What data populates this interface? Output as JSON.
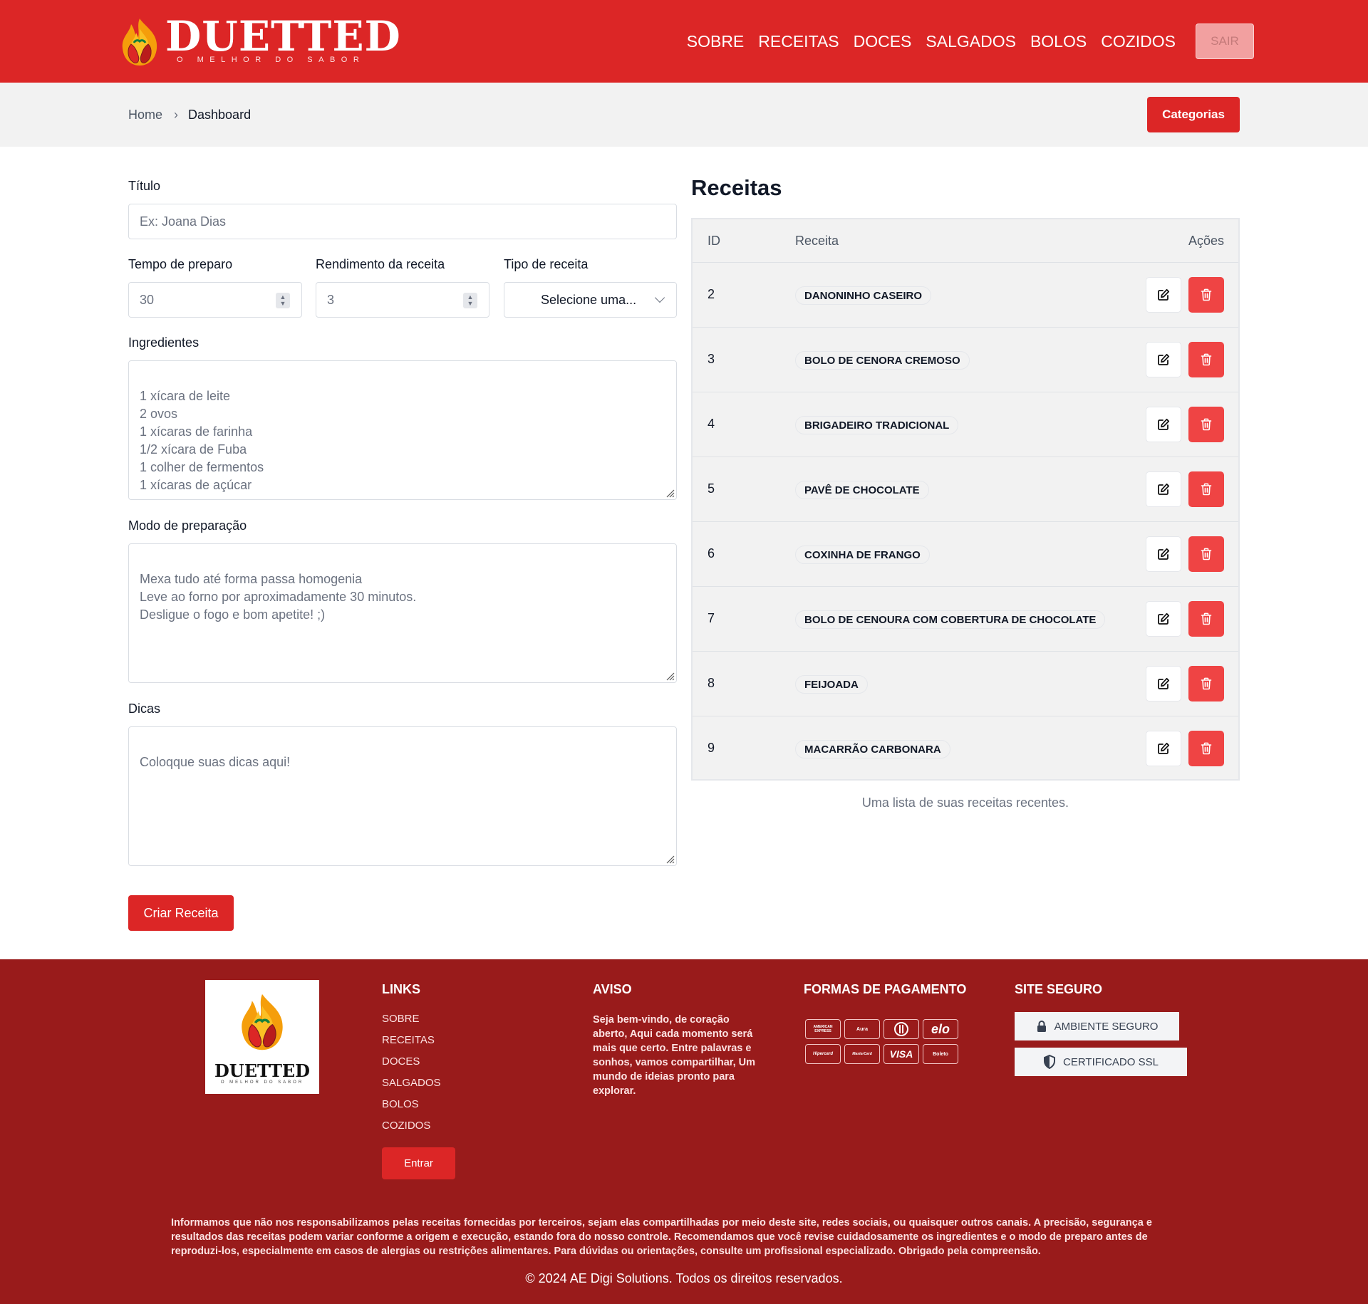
{
  "brand": {
    "name": "DUETTED",
    "tagline": "O MELHOR DO SABOR",
    "accent": "#dc2626",
    "footer_bg": "#991b1b"
  },
  "nav": {
    "items": [
      "SOBRE",
      "RECEITAS",
      "DOCES",
      "SALGADOS",
      "BOLOS",
      "COZIDOS"
    ],
    "logout_label": "SAIR"
  },
  "breadcrumb": {
    "home": "Home",
    "current": "Dashboard"
  },
  "header_actions": {
    "categories_label": "Categorias"
  },
  "form": {
    "title_label": "Título",
    "title_placeholder": "Ex: Joana Dias",
    "prep_time_label": "Tempo de preparo",
    "prep_time_value": "30",
    "yield_label": "Rendimento da receita",
    "yield_value": "3",
    "type_label": "Tipo de receita",
    "type_value": "Selecione uma...",
    "ingredients_label": "Ingredientes",
    "ingredients_placeholder": "1 xícara de leite\n2 ovos\n1 xícaras de farinha\n1/2 xícara de Fuba\n1 colher de fermentos\n1 xícaras de açúcar",
    "method_label": "Modo de preparação",
    "method_placeholder": "Mexa tudo até forma passa homogenia\nLeve ao forno por aproximadamente 30 minutos.\nDesligue o fogo e bom apetite! ;)",
    "tips_label": "Dicas",
    "tips_placeholder": "Coloqque suas dicas aqui!",
    "submit_label": "Criar Receita"
  },
  "recipes": {
    "title": "Receitas",
    "columns": [
      "ID",
      "Receita",
      "Ações"
    ],
    "rows": [
      {
        "id": "2",
        "name": "DANONINHO CASEIRO"
      },
      {
        "id": "3",
        "name": "BOLO DE CENORA CREMOSO"
      },
      {
        "id": "4",
        "name": "BRIGADEIRO TRADICIONAL"
      },
      {
        "id": "5",
        "name": "PAVÊ DE CHOCOLATE"
      },
      {
        "id": "6",
        "name": "COXINHA DE FRANGO"
      },
      {
        "id": "7",
        "name": "BOLO DE CENOURA COM COBERTURA DE CHOCOLATE"
      },
      {
        "id": "8",
        "name": "FEIJOADA"
      },
      {
        "id": "9",
        "name": "MACARRÃO CARBONARA"
      }
    ],
    "caption": "Uma lista de suas receitas recentes."
  },
  "footer": {
    "logo_name": "DUETTED",
    "logo_tagline": "O MELHOR DO SABOR",
    "links_title": "LINKS",
    "links": [
      "SOBRE",
      "RECEITAS",
      "DOCES",
      "SALGADOS",
      "BOLOS",
      "COZIDOS"
    ],
    "login_label": "Entrar",
    "notice_title": "AVISO",
    "notice_text": "Seja bem-vindo, de coração aberto, Aqui cada momento será mais que certo. Entre palavras e sonhos, vamos compartilhar, Um mundo de ideias pronto para explorar.",
    "payment_title": "FORMAS DE PAGAMENTO",
    "payment_methods": [
      "AMERICAN EXPRESS",
      "Aura",
      "Diners",
      "elo",
      "Hipercard",
      "MasterCard",
      "VISA",
      "Boleto"
    ],
    "secure_title": "SITE SEGURO",
    "secure_badges": [
      "AMBIENTE SEGURO",
      "CERTIFICADO SSL"
    ],
    "disclaimer": "Informamos que não nos responsabilizamos pelas receitas fornecidas por terceiros, sejam elas compartilhadas por meio deste site, redes sociais, ou quaisquer outros canais. A precisão, segurança e resultados das receitas podem variar conforme a origem e execução, estando fora do nosso controle. Recomendamos que você revise cuidadosamente os ingredientes e o modo de preparo antes de reproduzi-los, especialmente em casos de alergias ou restrições alimentares. Para dúvidas ou orientações, consulte um profissional especializado. Obrigado pela compreensão.",
    "copyright": "© 2024 AE Digi Solutions. Todos os direitos reservados."
  }
}
